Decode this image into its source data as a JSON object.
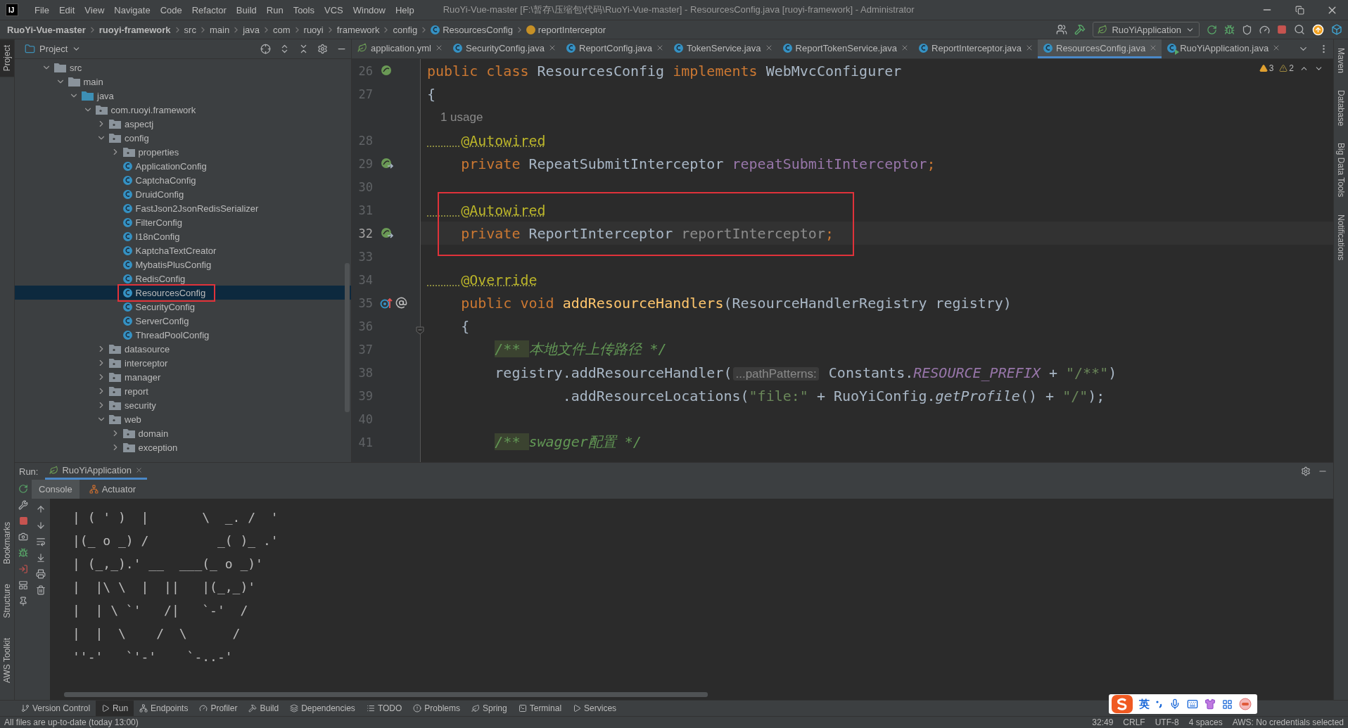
{
  "window": {
    "logo": "IJ",
    "menu": [
      "File",
      "Edit",
      "View",
      "Navigate",
      "Code",
      "Refactor",
      "Build",
      "Run",
      "Tools",
      "VCS",
      "Window",
      "Help"
    ],
    "title": "RuoYi-Vue-master [F:\\暂存\\压缩包\\代码\\RuoYi-Vue-master] - ResourcesConfig.java [ruoyi-framework] - Administrator"
  },
  "breadcrumbs": [
    {
      "label": "RuoYi-Vue-master",
      "kind": "module"
    },
    {
      "label": "ruoyi-framework",
      "kind": "module"
    },
    {
      "label": "src",
      "kind": "dir"
    },
    {
      "label": "main",
      "kind": "dir"
    },
    {
      "label": "java",
      "kind": "dir"
    },
    {
      "label": "com",
      "kind": "dir"
    },
    {
      "label": "ruoyi",
      "kind": "dir"
    },
    {
      "label": "framework",
      "kind": "dir"
    },
    {
      "label": "config",
      "kind": "dir"
    },
    {
      "label": "ResourcesConfig",
      "kind": "class"
    },
    {
      "label": "reportInterceptor",
      "kind": "field"
    }
  ],
  "run_config": {
    "label": "RuoYiApplication"
  },
  "tool_strips": {
    "left_top": [
      {
        "label": "Project",
        "selected": true
      }
    ],
    "left_bottom": [
      {
        "label": "Bookmarks",
        "selected": false
      },
      {
        "label": "Structure",
        "selected": false
      },
      {
        "label": "AWS Toolkit",
        "selected": false
      }
    ],
    "right": [
      {
        "label": "Maven",
        "selected": false
      },
      {
        "label": "Database",
        "selected": false
      },
      {
        "label": "Big Data Tools",
        "selected": false
      },
      {
        "label": "Notifications",
        "selected": false
      }
    ]
  },
  "project": {
    "title": "Project",
    "tree": [
      {
        "label": "src",
        "kind": "folder",
        "expanded": true,
        "selected": false,
        "children": [
          {
            "label": "main",
            "kind": "folder",
            "expanded": true,
            "selected": false,
            "children": [
              {
                "label": "java",
                "kind": "source",
                "expanded": true,
                "selected": false,
                "children": [
                  {
                    "label": "com.ruoyi.framework",
                    "kind": "package",
                    "expanded": true,
                    "selected": false,
                    "children": [
                      {
                        "label": "aspectj",
                        "kind": "package",
                        "expanded": false,
                        "selected": false
                      },
                      {
                        "label": "config",
                        "kind": "package",
                        "expanded": true,
                        "selected": false,
                        "children": [
                          {
                            "label": "properties",
                            "kind": "package",
                            "expanded": false,
                            "selected": false
                          },
                          {
                            "label": "ApplicationConfig",
                            "kind": "class",
                            "selected": false
                          },
                          {
                            "label": "CaptchaConfig",
                            "kind": "class",
                            "selected": false
                          },
                          {
                            "label": "DruidConfig",
                            "kind": "class",
                            "selected": false
                          },
                          {
                            "label": "FastJson2JsonRedisSerializer",
                            "kind": "class",
                            "selected": false
                          },
                          {
                            "label": "FilterConfig",
                            "kind": "class",
                            "selected": false
                          },
                          {
                            "label": "I18nConfig",
                            "kind": "class",
                            "selected": false
                          },
                          {
                            "label": "KaptchaTextCreator",
                            "kind": "class",
                            "selected": false
                          },
                          {
                            "label": "MybatisPlusConfig",
                            "kind": "class",
                            "selected": false
                          },
                          {
                            "label": "RedisConfig",
                            "kind": "class",
                            "selected": false
                          },
                          {
                            "label": "ResourcesConfig",
                            "kind": "class",
                            "selected": true,
                            "boxed": true
                          },
                          {
                            "label": "SecurityConfig",
                            "kind": "class",
                            "selected": false
                          },
                          {
                            "label": "ServerConfig",
                            "kind": "class",
                            "selected": false
                          },
                          {
                            "label": "ThreadPoolConfig",
                            "kind": "class",
                            "selected": false
                          }
                        ]
                      },
                      {
                        "label": "datasource",
                        "kind": "package",
                        "expanded": false,
                        "selected": false
                      },
                      {
                        "label": "interceptor",
                        "kind": "package",
                        "expanded": false,
                        "selected": false
                      },
                      {
                        "label": "manager",
                        "kind": "package",
                        "expanded": false,
                        "selected": false
                      },
                      {
                        "label": "report",
                        "kind": "package",
                        "expanded": false,
                        "selected": false
                      },
                      {
                        "label": "security",
                        "kind": "package",
                        "expanded": false,
                        "selected": false
                      },
                      {
                        "label": "web",
                        "kind": "package",
                        "expanded": true,
                        "selected": false,
                        "children": [
                          {
                            "label": "domain",
                            "kind": "package",
                            "expanded": false,
                            "selected": false
                          },
                          {
                            "label": "exception",
                            "kind": "package",
                            "expanded": false,
                            "selected": false
                          }
                        ]
                      }
                    ]
                  }
                ]
              }
            ]
          }
        ]
      }
    ]
  },
  "editor": {
    "tabs": [
      {
        "label": "application.yml",
        "kind": "yaml",
        "selected": false
      },
      {
        "label": "SecurityConfig.java",
        "kind": "class",
        "selected": false
      },
      {
        "label": "ReportConfig.java",
        "kind": "class",
        "selected": false
      },
      {
        "label": "TokenService.java",
        "kind": "class",
        "selected": false
      },
      {
        "label": "ReportTokenService.java",
        "kind": "class",
        "selected": false
      },
      {
        "label": "ReportInterceptor.java",
        "kind": "class",
        "selected": false
      },
      {
        "label": "ResourcesConfig.java",
        "kind": "class",
        "selected": true
      },
      {
        "label": "RuoYiApplication.java",
        "kind": "app",
        "selected": false
      }
    ],
    "inspections": [
      {
        "count": "3",
        "kind": "warning"
      },
      {
        "count": "2",
        "kind": "weak"
      }
    ],
    "lines": [
      {
        "num": "26",
        "kind": "code",
        "gutter": {
          "kind": "bean"
        },
        "tokens": [
          {
            "text": "public class ",
            "kind": "keyword"
          },
          {
            "text": "ResourcesConfig ",
            "kind": "plain"
          },
          {
            "text": "implements ",
            "kind": "keyword"
          },
          {
            "text": "WebMvcConfigurer",
            "kind": "plain"
          }
        ]
      },
      {
        "num": "27",
        "kind": "code",
        "tokens": [
          {
            "text": "{",
            "kind": "plain"
          }
        ]
      },
      {
        "kind": "usage",
        "tokens": [
          {
            "text": "    1 usage",
            "kind": "usage"
          }
        ]
      },
      {
        "num": "28",
        "kind": "code",
        "tokens": [
          {
            "text": "    @Autowired",
            "kind": "annotation"
          }
        ]
      },
      {
        "num": "29",
        "kind": "code",
        "gutter": {
          "kind": "inject"
        },
        "tokens": [
          {
            "text": "    private ",
            "kind": "keyword"
          },
          {
            "text": "RepeatSubmitInterceptor ",
            "kind": "plain"
          },
          {
            "text": "repeatSubmitInterceptor",
            "kind": "field"
          },
          {
            "text": ";",
            "kind": "keyword"
          }
        ]
      },
      {
        "num": "30",
        "kind": "code"
      },
      {
        "num": "31",
        "kind": "code",
        "boxed": true,
        "tokens": [
          {
            "text": "    @Autowired",
            "kind": "annotation"
          }
        ]
      },
      {
        "num": "32",
        "kind": "code",
        "boxed": true,
        "current": true,
        "gutter": {
          "kind": "inject"
        },
        "tokens": [
          {
            "text": "    private ",
            "kind": "keyword"
          },
          {
            "text": "ReportInterceptor ",
            "kind": "plain"
          },
          {
            "text": "reportInterceptor",
            "kind": "unused"
          },
          {
            "text": ";",
            "kind": "keyword"
          }
        ]
      },
      {
        "num": "33",
        "kind": "code"
      },
      {
        "num": "34",
        "kind": "code",
        "tokens": [
          {
            "text": "    @Override",
            "kind": "annotation"
          }
        ]
      },
      {
        "num": "35",
        "kind": "code",
        "gutter": {
          "kind": "override"
        },
        "tokens": [
          {
            "text": "    public void ",
            "kind": "keyword"
          },
          {
            "text": "addResourceHandlers",
            "kind": "decl"
          },
          {
            "text": "(ResourceHandlerRegistry registry)",
            "kind": "plain"
          }
        ]
      },
      {
        "num": "36",
        "kind": "code",
        "gutter": {
          "kind": "fold"
        },
        "tokens": [
          {
            "text": "    {",
            "kind": "plain"
          }
        ]
      },
      {
        "num": "37",
        "kind": "code",
        "tokens": [
          {
            "text": "        /** ",
            "kind": "doc"
          },
          {
            "text": "本地文件上传路径 */",
            "kind": "comment"
          }
        ]
      },
      {
        "num": "38",
        "kind": "code",
        "tokens": [
          {
            "text": "        registry.addResourceHandler(",
            "kind": "plain"
          },
          {
            "text": "...pathPatterns:",
            "kind": "hint"
          },
          {
            "text": " Constants.",
            "kind": "plain"
          },
          {
            "text": "RESOURCE_PREFIX",
            "kind": "static"
          },
          {
            "text": " + ",
            "kind": "plain"
          },
          {
            "text": "\"/**\"",
            "kind": "string"
          },
          {
            "text": ")",
            "kind": "plain"
          }
        ]
      },
      {
        "num": "39",
        "kind": "code",
        "tokens": [
          {
            "text": "                .addResourceLocations(",
            "kind": "plain"
          },
          {
            "text": "\"file:\"",
            "kind": "string"
          },
          {
            "text": " + RuoYiConfig.",
            "kind": "plain"
          },
          {
            "text": "getProfile",
            "kind": "call"
          },
          {
            "text": "() + ",
            "kind": "plain"
          },
          {
            "text": "\"/\"",
            "kind": "string"
          },
          {
            "text": ");",
            "kind": "plain"
          }
        ]
      },
      {
        "num": "40",
        "kind": "code"
      },
      {
        "num": "41",
        "kind": "code",
        "tokens": [
          {
            "text": "        /** ",
            "kind": "doc"
          },
          {
            "text": "swagger配置 */",
            "kind": "comment"
          }
        ]
      }
    ]
  },
  "run": {
    "label": "Run:",
    "tab": "RuoYiApplication",
    "subtabs": [
      {
        "label": "Console",
        "selected": true
      },
      {
        "label": "Actuator",
        "selected": false
      }
    ],
    "console": [
      "| ( ' )  |       \\  _. /  '",
      "|(_ o _) /         _( )_ .'",
      "| (_,_).' __  ___(_ o _)'",
      "|  |\\ \\  |  ||   |(_,_)'",
      "|  | \\ `'   /|   `-'  /",
      "|  |  \\    /  \\      /",
      "''-'   `'-'    `-..-'"
    ]
  },
  "bottom_tabs": [
    {
      "label": "Version Control",
      "selected": false
    },
    {
      "label": "Run",
      "selected": true
    },
    {
      "label": "Endpoints",
      "selected": false
    },
    {
      "label": "Profiler",
      "selected": false
    },
    {
      "label": "Build",
      "selected": false
    },
    {
      "label": "Dependencies",
      "selected": false
    },
    {
      "label": "TODO",
      "selected": false
    },
    {
      "label": "Problems",
      "selected": false
    },
    {
      "label": "Spring",
      "selected": false
    },
    {
      "label": "Terminal",
      "selected": false
    },
    {
      "label": "Services",
      "selected": false
    }
  ],
  "status": {
    "message": "All files are up-to-date (today 13:00)",
    "items": [
      "32:49",
      "CRLF",
      "UTF-8",
      "4 spaces",
      "AWS: No credentials selected"
    ]
  },
  "ime": {
    "label": "英"
  }
}
